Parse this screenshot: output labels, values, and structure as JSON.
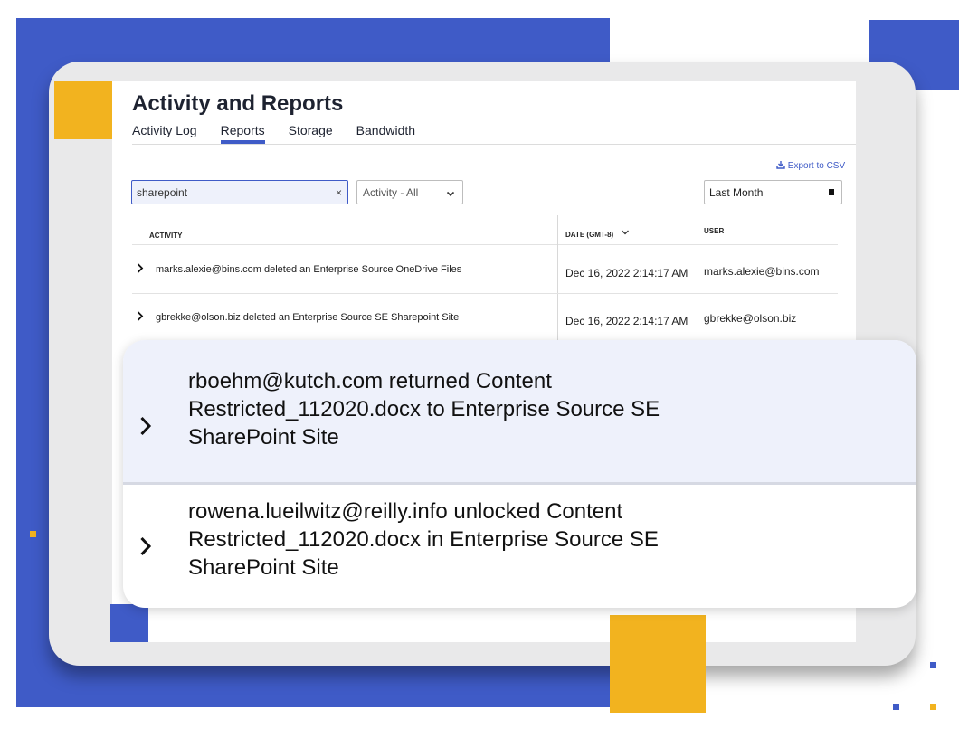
{
  "page": {
    "title": "Activity and Reports"
  },
  "tabs": [
    {
      "label": "Activity Log",
      "active": false
    },
    {
      "label": "Reports",
      "active": true
    },
    {
      "label": "Storage",
      "active": false
    },
    {
      "label": "Bandwidth",
      "active": false
    }
  ],
  "toolbar": {
    "export_label": "Export to CSV",
    "search_value": "sharepoint",
    "clear_icon": "×",
    "activity_filter": "Activity - All",
    "date_filter": "Last Month"
  },
  "table": {
    "headers": {
      "activity": "ACTIVITY",
      "date": "DATE (GMT-8)",
      "user": "USER"
    },
    "rows": [
      {
        "activity": "marks.alexie@bins.com deleted an Enterprise Source OneDrive Files",
        "date": "Dec 16, 2022 2:14:17 AM",
        "user": "marks.alexie@bins.com"
      },
      {
        "activity": "gbrekke@olson.biz deleted an Enterprise Source SE Sharepoint Site",
        "date": "Dec 16, 2022 2:14:17 AM",
        "user": "gbrekke@olson.biz"
      }
    ]
  },
  "highlight": [
    {
      "text": "rboehm@kutch.com returned Content Restricted_112020.docx to Enterprise Source SE SharePoint Site"
    },
    {
      "text": "rowena.lueilwitz@reilly.info unlocked Content Restricted_112020.docx in Enterprise Source SE SharePoint Site"
    }
  ],
  "icons": {
    "expand": "chevron-right-icon",
    "sort": "chevron-down-icon",
    "calendar": "calendar-icon",
    "download": "download-icon"
  },
  "colors": {
    "accent": "#3f5bc7",
    "gold": "#f2b31f",
    "highlight_bg": "#eef1fb"
  }
}
